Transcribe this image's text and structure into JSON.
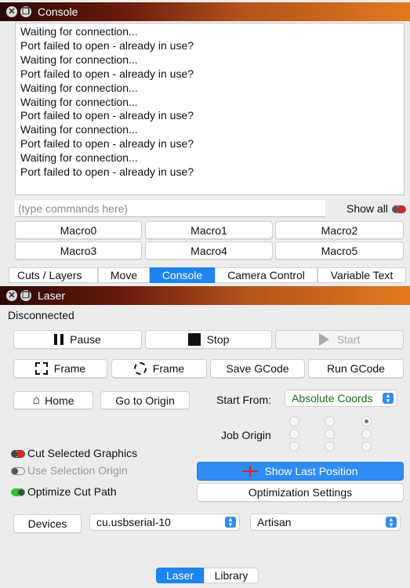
{
  "console_window": {
    "title": "Console",
    "log_lines": [
      "Waiting for connection...",
      "Port failed to open - already in use?",
      "Waiting for connection...",
      "Port failed to open - already in use?",
      "Waiting for connection...",
      "Waiting for connection...",
      "Port failed to open - already in use?",
      "Waiting for connection...",
      "Port failed to open - already in use?",
      "Waiting for connection...",
      "Port failed to open - already in use?"
    ],
    "command_placeholder": "(type commands here)",
    "show_all_label": "Show all",
    "show_all_color": "#d9261c",
    "macros": [
      "Macro0",
      "Macro1",
      "Macro2",
      "Macro3",
      "Macro4",
      "Macro5"
    ]
  },
  "tabs": {
    "items": [
      "Cuts / Layers",
      "Move",
      "Console",
      "Camera Control",
      "Variable Text"
    ],
    "active": "Console"
  },
  "laser_window": {
    "title": "Laser",
    "status": "Disconnected",
    "pause_label": "Pause",
    "stop_label": "Stop",
    "start_label": "Start",
    "frame_label_1": "Frame",
    "frame_label_2": "Frame",
    "save_gcode_label": "Save GCode",
    "run_gcode_label": "Run GCode",
    "home_label": "Home",
    "go_to_origin_label": "Go to Origin",
    "start_from_label": "Start From:",
    "start_from_value": "Absolute Coords",
    "start_from_color": "#1c6b1c",
    "job_origin_label": "Job Origin",
    "cut_selected_label": "Cut Selected Graphics",
    "cut_selected_color": "#d9261c",
    "use_selection_origin_label": "Use Selection Origin",
    "optimize_cut_path_label": "Optimize Cut Path",
    "optimize_color": "#2cc02c",
    "show_last_position_label": "Show Last Position",
    "optimization_settings_label": "Optimization Settings",
    "devices_label": "Devices",
    "port_value": "cu.usbserial-10",
    "device_profile_value": "Artisan"
  },
  "bottom_tabs": {
    "items": [
      "Laser",
      "Library"
    ],
    "active": "Laser"
  },
  "colors": {
    "accent": "#2e8cf4",
    "title_gradient_start": "#2a0a06",
    "title_gradient_end": "#e2781e"
  }
}
